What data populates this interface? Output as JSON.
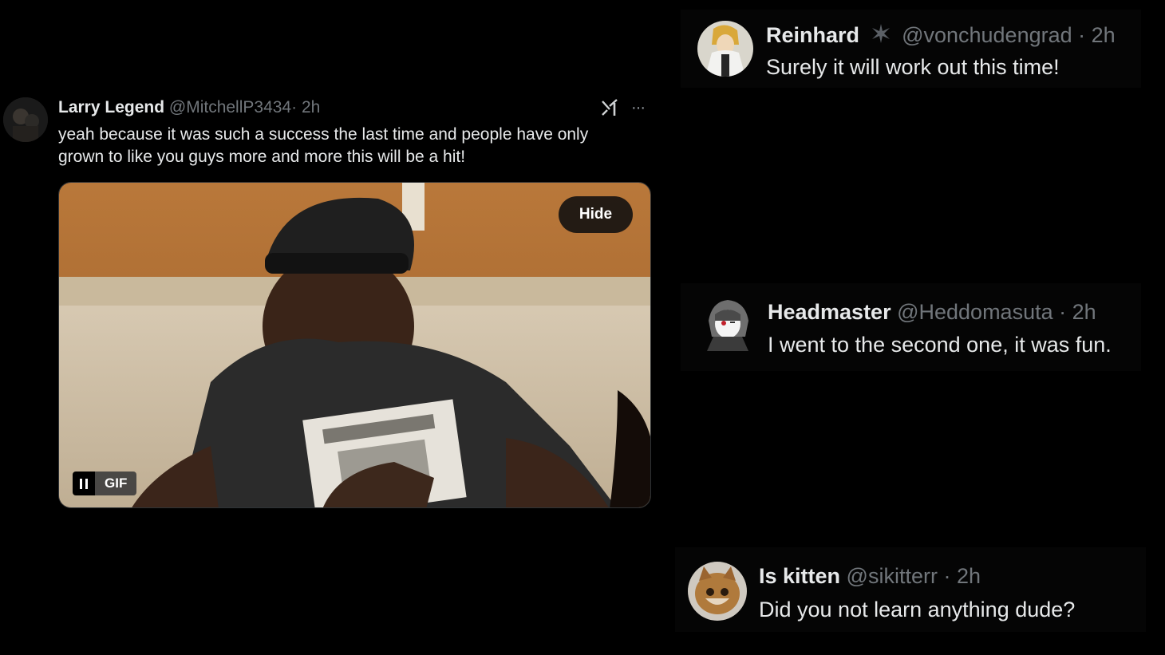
{
  "main_tweet": {
    "name": "Larry Legend",
    "handle": "@MitchellP3434",
    "time": "· 2h",
    "text": "yeah because it was such a success the last time and people have only grown to like you guys more and more this will be a hit!",
    "grok_icon": "grok-icon",
    "more_icon": "more-icon",
    "more_label": "···",
    "media": {
      "hide_label": "Hide",
      "gif_label": "GIF",
      "pause_icon": "pause-icon"
    }
  },
  "replies": [
    {
      "name": "Reinhard",
      "badge_icon": "verified-star-icon",
      "handle": "@vonchudengrad",
      "time": "· 2h",
      "text": "Surely it will work out this time!"
    },
    {
      "name": "Headmaster",
      "handle": "@Heddomasuta",
      "time": "· 2h",
      "text": "I went to the second one, it was fun."
    },
    {
      "name": "Is kitten",
      "handle": "@sikitterr",
      "time": "· 2h",
      "text": "Did you not learn anything dude?"
    }
  ],
  "colors": {
    "background": "#000000",
    "text": "#e7e9ea",
    "handle": "#71767b"
  }
}
